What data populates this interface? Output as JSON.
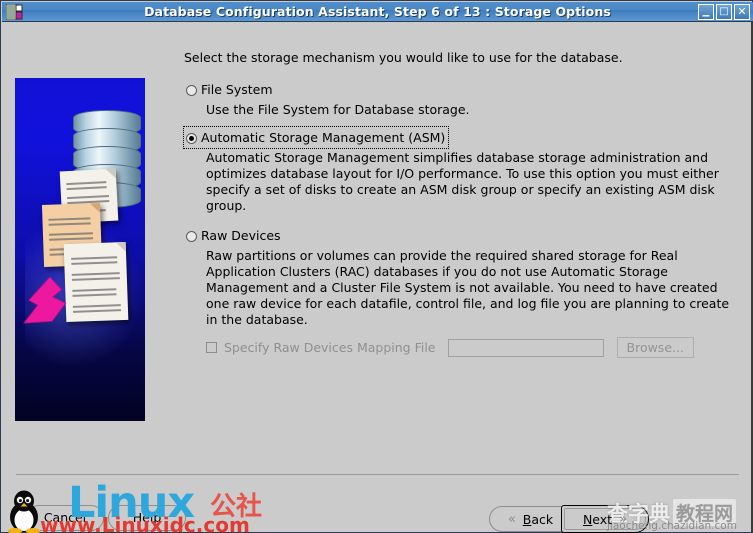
{
  "window": {
    "title": "Database Configuration Assistant, Step 6 of 13 : Storage Options",
    "icon_name": "app-icon",
    "controls": {
      "minimize": "_",
      "maximize": "□",
      "close": "✕"
    },
    "titlebar_color": "#4a87c6",
    "client_bg": "#cbcbcb"
  },
  "illustration": {
    "name": "database-storage-illustration",
    "bg_top_color": "#1111d6",
    "bg_bottom_color": "#020222",
    "arrow_color": "#e8179b"
  },
  "content": {
    "intro": "Select the storage mechanism you would like to use for the database.",
    "options": [
      {
        "id": "file-system",
        "label": "File System",
        "selected": false,
        "focused": false,
        "description": "Use the File System for Database storage."
      },
      {
        "id": "asm",
        "label": "Automatic Storage Management (ASM)",
        "selected": true,
        "focused": true,
        "description": "Automatic Storage Management simplifies database storage administration and optimizes database layout for I/O performance. To use this option you must either specify a set of disks to create an ASM disk group or specify an existing ASM disk group."
      },
      {
        "id": "raw-devices",
        "label": "Raw Devices",
        "selected": false,
        "focused": false,
        "description": "Raw partitions or volumes can provide the required shared storage for Real Application Clusters (RAC) databases if you do not use Automatic Storage Management and a Cluster File System is not available.  You need to have created one raw device for each datafile, control file, and log file you are planning to create in the database."
      }
    ],
    "raw_mapping": {
      "checkbox_label": "Specify Raw Devices Mapping File",
      "checked": false,
      "disabled": true,
      "field_value": "",
      "field_placeholder": "",
      "browse_label": "Browse..."
    }
  },
  "footer": {
    "cancel_label": "Cancel",
    "help_label": "Help",
    "back_label": "Back",
    "back_mnemonic": "B",
    "next_label": "Next",
    "next_mnemonic": "N",
    "back_chevron": "«",
    "next_chevron": "»"
  },
  "watermarks": {
    "linux_word": "Linux",
    "linux_cn": "公社",
    "linux_url": "www.Linuxidc.com",
    "chazidian_cn1": "查字典",
    "chazidian_cn2": "教程网",
    "chazidian_url": "jiaocheng.chazidian.com"
  }
}
